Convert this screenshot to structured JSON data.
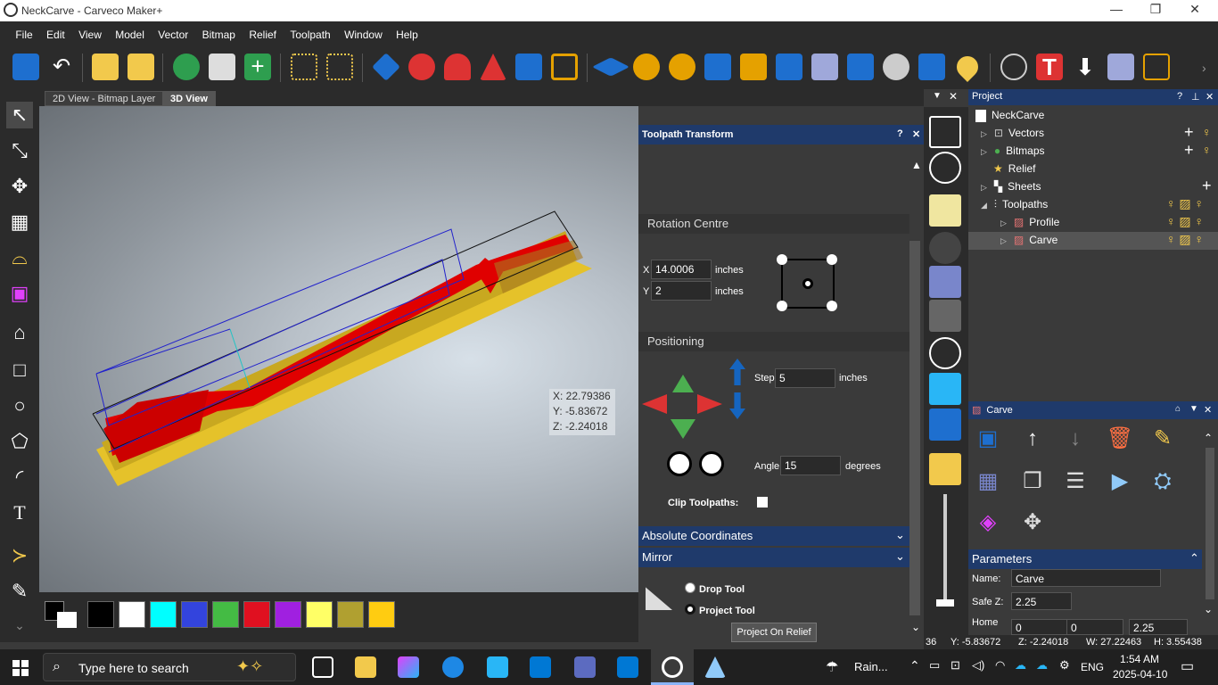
{
  "window": {
    "title": "NeckCarve - Carveco Maker+"
  },
  "menu": [
    "File",
    "Edit",
    "View",
    "Model",
    "Vector",
    "Bitmap",
    "Relief",
    "Toolpath",
    "Window",
    "Help"
  ],
  "tabs": [
    "2D View - Bitmap Layer",
    "3D View"
  ],
  "coords_overlay": {
    "x": "X: 22.79386",
    "y": "Y: -5.83672",
    "z": "Z: -2.24018"
  },
  "toolpath_transform": {
    "title": "Toolpath Transform",
    "help": "?",
    "close": "✕",
    "rotation_centre": "Rotation Centre",
    "x_label": "X",
    "x_value": "14.0006",
    "y_label": "Y",
    "y_value": "2",
    "units": "inches",
    "positioning": "Positioning",
    "step_label": "Step",
    "step_value": "5",
    "angle_label": "Angle",
    "angle_value": "15",
    "degrees": "degrees",
    "clip_label": "Clip Toolpaths:",
    "absolute": "Absolute Coordinates",
    "mirror": "Mirror",
    "drop_tool": "Drop Tool",
    "project_tool": "Project Tool",
    "project_on_relief": "Project On Relief"
  },
  "project": {
    "title": "Project",
    "items": [
      "NeckCarve",
      "Vectors",
      "Bitmaps",
      "Relief",
      "Sheets",
      "Toolpaths",
      "Profile",
      "Carve"
    ]
  },
  "carve_panel": {
    "title": "Carve",
    "parameters": "Parameters",
    "name_label": "Name:",
    "name_value": "Carve",
    "safez_label": "Safe Z:",
    "safez_value": "2.25",
    "home_label": "Home",
    "home_x": "0",
    "home_y": "0",
    "home_z": "2.25"
  },
  "status": {
    "y": "Y: -5.83672",
    "z": "Z: -2.24018",
    "w": "W: 27.22463",
    "h": "H: 3.55438",
    "lead": "36"
  },
  "taskbar": {
    "search": "Type here to search",
    "weather": "Rain...",
    "lang": "ENG",
    "time": "1:54 AM",
    "date": "2025-04-10"
  },
  "colors": {
    "accent": "#1f3a6b",
    "toolpath": "#e00000",
    "relief": "#e5c22a"
  }
}
